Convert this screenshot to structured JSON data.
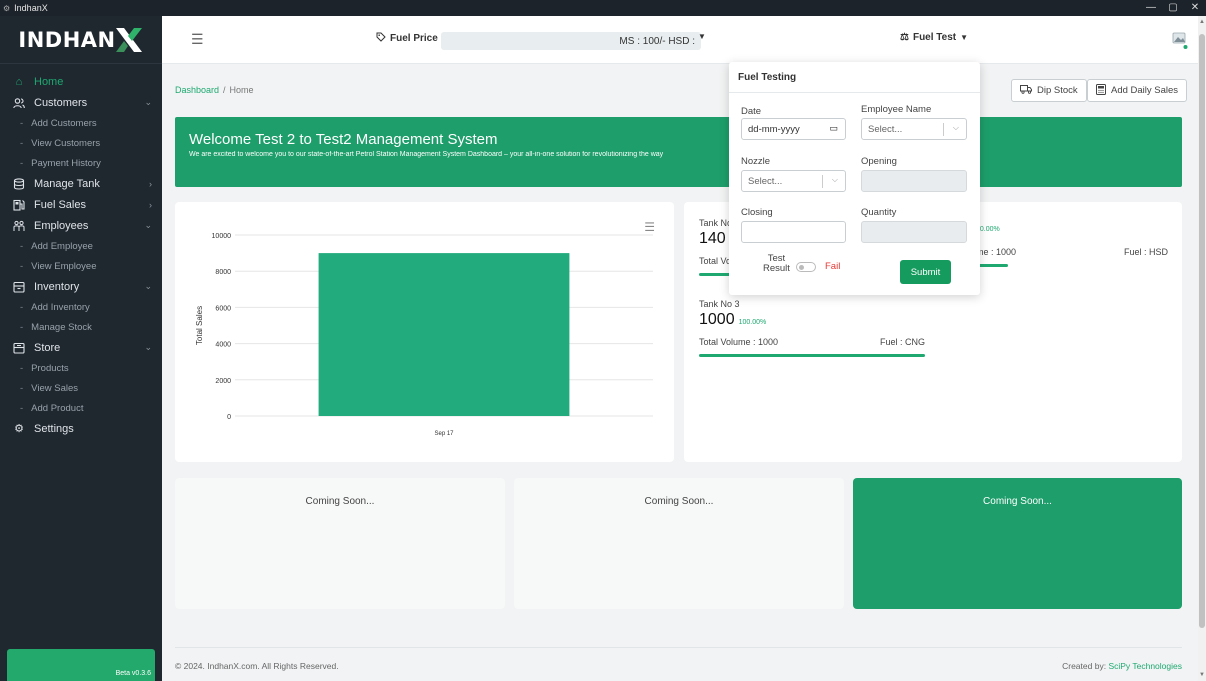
{
  "window": {
    "title": "IndhanX",
    "min": "—",
    "max": "▢",
    "close": "✕"
  },
  "brand": {
    "logo": "INDHAN"
  },
  "sidebar": {
    "items": [
      {
        "label": "Home",
        "icon": "home-icon",
        "active": true,
        "chevron": ""
      },
      {
        "label": "Customers",
        "icon": "users-icon",
        "chevron": "⌄",
        "children": [
          "Add Customers",
          "View Customers",
          "Payment History"
        ]
      },
      {
        "label": "Manage Tank",
        "icon": "database-icon",
        "chevron": "›"
      },
      {
        "label": "Fuel Sales",
        "icon": "fuel-pump-icon",
        "chevron": "›"
      },
      {
        "label": "Employees",
        "icon": "people-icon",
        "chevron": "⌄",
        "children": [
          "Add Employee",
          "View Employee"
        ]
      },
      {
        "label": "Inventory",
        "icon": "archive-icon",
        "chevron": "⌄",
        "children": [
          "Add Inventory",
          "Manage Stock"
        ]
      },
      {
        "label": "Store",
        "icon": "store-icon",
        "chevron": "⌄",
        "children": [
          "Products",
          "View Sales",
          "Add Product"
        ]
      },
      {
        "label": "Settings",
        "icon": "gear-icon",
        "chevron": ""
      }
    ],
    "beta": "Beta v0.3.6"
  },
  "topbar": {
    "fuel_price_label": "Fuel Price",
    "fuel_price_value": "MS : 100/-    HSD :",
    "fuel_test_label": "Fuel Test"
  },
  "breadcrumb": {
    "root": "Dashboard",
    "sep": "/",
    "current": "Home"
  },
  "actions": {
    "dip_stock": "Dip Stock",
    "add_daily_sales": "Add Daily Sales"
  },
  "welcome": {
    "title": "Welcome Test 2 to Test2 Management System",
    "text": "We are excited to welcome you to our state-of-the-art Petrol Station Management System Dashboard – your all-in-one solution for revolutionizing the way"
  },
  "chart_data": {
    "type": "bar",
    "categories": [
      "Sep 17"
    ],
    "values": [
      9000
    ],
    "ylabel": "Total Sales",
    "ylim": [
      0,
      10000
    ],
    "yticks": [
      0,
      2000,
      4000,
      6000,
      8000,
      10000
    ],
    "color": "#22ab7d"
  },
  "tanks": [
    {
      "name": "Tank No",
      "value": "140",
      "pct": "",
      "info_left": "Total Vo",
      "info_right": "",
      "fill": 0.14
    },
    {
      "name": "",
      "value": "",
      "pct": "30.00%",
      "info_left": "me : 1000",
      "info_right": "Fuel : HSD",
      "fill": 0.3
    },
    {
      "name": "Tank No 3",
      "value": "1000",
      "pct": "100.00%",
      "info_left": "Total Volume : 1000",
      "info_right": "Fuel : CNG",
      "fill": 1.0
    }
  ],
  "coming_soon": [
    "Coming Soon...",
    "Coming Soon...",
    "Coming Soon..."
  ],
  "footer": {
    "copyright": "© 2024. IndhanX.com. All Rights Reserved.",
    "created_by": "Created by:",
    "company": "SciPy Technologies"
  },
  "fuel_testing": {
    "title": "Fuel Testing",
    "date_label": "Date",
    "date_placeholder": "dd-mm-yyyy",
    "employee_label": "Employee Name",
    "employee_placeholder": "Select...",
    "nozzle_label": "Nozzle",
    "nozzle_placeholder": "Select...",
    "opening_label": "Opening",
    "closing_label": "Closing",
    "quantity_label": "Quantity",
    "test_result_label_1": "Test",
    "test_result_label_2": "Result",
    "test_result_value": "Fail",
    "submit": "Submit"
  },
  "colors": {
    "accent": "#1fa971",
    "banner": "#1d9e6a",
    "sidebar": "#1f272f",
    "fail": "#e53935"
  }
}
